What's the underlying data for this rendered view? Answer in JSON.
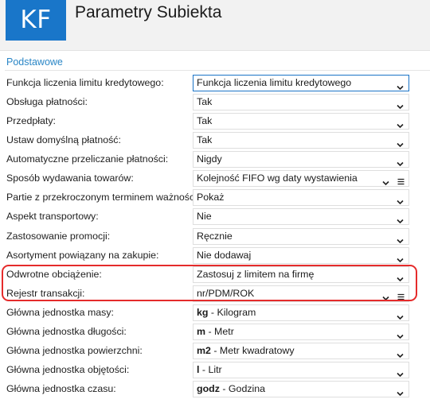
{
  "header": {
    "logo_text": "KF",
    "title": "Parametry Subiekta"
  },
  "section": {
    "title": "Podstawowe"
  },
  "colors": {
    "accent": "#1976c9",
    "section_title": "#2a86c6",
    "highlight": "#e52b2b",
    "header_bg": "#f2f2f2"
  },
  "rows": [
    {
      "label": "Funkcja liczenia limitu kredytowego:",
      "value": "Funkcja liczenia limitu kredytowego",
      "icon": "chevron-down-icon"
    },
    {
      "label": "Obsługa płatności:",
      "value": "Tak",
      "icon": "chevron-down-icon"
    },
    {
      "label": "Przedpłaty:",
      "value": "Tak",
      "icon": "chevron-down-icon"
    },
    {
      "label": "Ustaw domyślną płatność:",
      "value": "Tak",
      "icon": "chevron-down-icon"
    },
    {
      "label": "Automatyczne przeliczanie płatności:",
      "value": "Nigdy",
      "icon": "chevron-down-icon"
    },
    {
      "label": "Sposób wydawania towarów:",
      "value": "Kolejność FIFO wg daty wystawienia",
      "icon": "chevron-down-icon",
      "extra_icon": "menu-icon"
    },
    {
      "label": "Partie z przekroczonym terminem ważności:",
      "value": "Pokaż",
      "icon": "chevron-down-icon"
    },
    {
      "label": "Aspekt transportowy:",
      "value": "Nie",
      "icon": "chevron-down-icon"
    },
    {
      "label": "Zastosowanie promocji:",
      "value": "Ręcznie",
      "icon": "chevron-down-icon"
    },
    {
      "label": "Asortyment powiązany na zakupie:",
      "value": "Nie dodawaj",
      "icon": "chevron-down-icon"
    },
    {
      "label": "Odwrotne obciążenie:",
      "value": "Zastosuj z limitem na firmę",
      "icon": "chevron-down-icon"
    },
    {
      "label": "Rejestr transakcji:",
      "value": "nr/PDM/ROK",
      "icon": "chevron-down-icon",
      "extra_icon": "menu-icon"
    },
    {
      "label": "Główna jednostka masy:",
      "value_code": "kg",
      "value": " - Kilogram",
      "icon": "chevron-down-icon"
    },
    {
      "label": "Główna jednostka długości:",
      "value_code": "m",
      "value": " - Metr",
      "icon": "chevron-down-icon"
    },
    {
      "label": "Główna jednostka powierzchni:",
      "value_code": "m2",
      "value": " - Metr kwadratowy",
      "icon": "chevron-down-icon"
    },
    {
      "label": "Główna jednostka objętości:",
      "value_code": "l",
      "value": " - Litr",
      "icon": "chevron-down-icon"
    },
    {
      "label": "Główna jednostka czasu:",
      "value_code": "godz",
      "value": " - Godzina",
      "icon": "chevron-down-icon"
    }
  ]
}
